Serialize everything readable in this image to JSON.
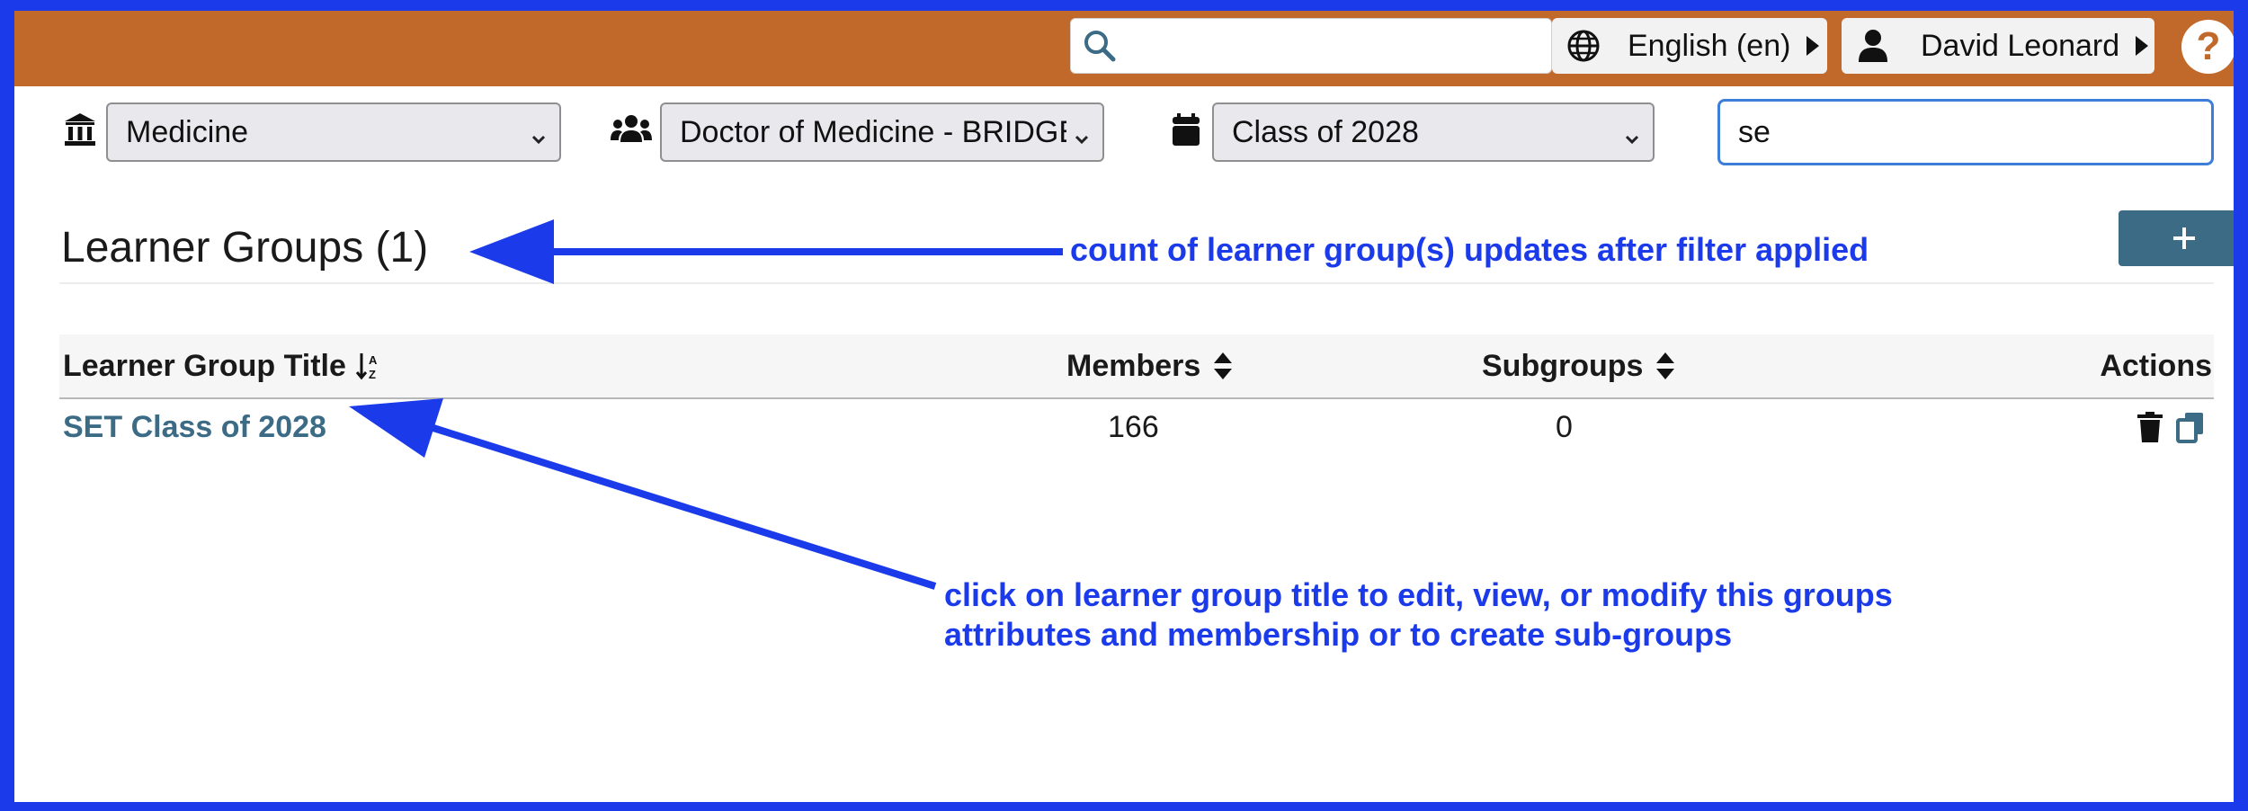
{
  "header": {
    "search": {
      "value": "",
      "placeholder": ""
    },
    "language": "English (en)",
    "user_name": "David Leonard",
    "help_label": "?"
  },
  "filters": {
    "school": "Medicine",
    "program": "Doctor of Medicine - BRIDGE",
    "cohort": "Class of 2028",
    "text_filter": "se"
  },
  "page": {
    "title": "Learner Groups (1)",
    "add_button_label": "+"
  },
  "table": {
    "columns": [
      "Learner Group Title",
      "Members",
      "Subgroups",
      "Actions"
    ],
    "rows": [
      {
        "title": "SET Class of 2028",
        "members": "166",
        "subgroups": "0"
      }
    ]
  },
  "annotations": {
    "count_note": "count of learner group(s) updates after filter applied",
    "title_note_line1": "click on learner group title to edit, view, or modify this groups",
    "title_note_line2": "attributes and membership or to create sub-groups"
  },
  "colors": {
    "header_bar": "#c1692a",
    "annotation": "#1b3bea",
    "link": "#3c6b86",
    "add_button": "#3c6b86"
  },
  "icons": [
    "search-icon",
    "globe-icon",
    "user-icon",
    "question-icon",
    "institution-icon",
    "users-icon",
    "calendar-icon",
    "chevron-down-icon",
    "plus-icon",
    "sort-alpha-icon",
    "sort-icon",
    "trash-icon",
    "copy-icon"
  ]
}
